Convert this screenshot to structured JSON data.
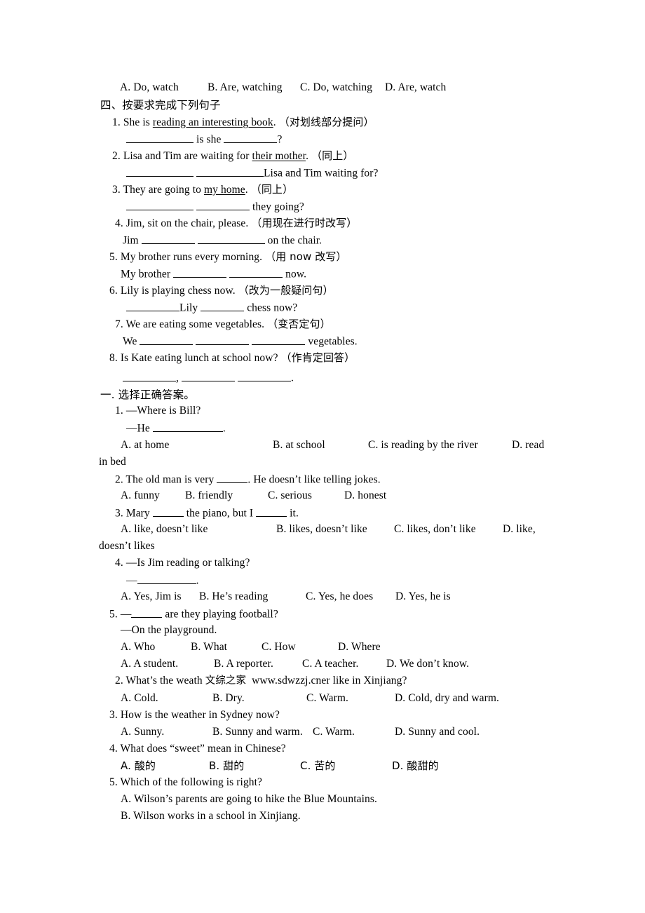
{
  "document": {
    "type": "exam-worksheet",
    "language": "en-zh",
    "page_background": "#ffffff",
    "text_color": "#000000"
  },
  "watermark": {
    "chinese": "文综之家",
    "url": "www.sdwzzj.cn",
    "host_word_prefix": "weath",
    "host_word_suffix": "er"
  },
  "top_options": {
    "a": "A. Do, watch",
    "b": "B. Are, watching",
    "c": "C. Do, watching",
    "d": "D. Are, watch"
  },
  "section_four": {
    "heading": "四、按要求完成下列句子",
    "items": [
      {
        "num": "1.",
        "stem_pre": "She is ",
        "stem_underlined": "reading an interesting book",
        "stem_post": ".",
        "instruction": "（对划线部分提问）",
        "answer_pre": "",
        "answer_mid": " is she ",
        "answer_post": "?"
      },
      {
        "num": "2.",
        "stem_pre": "Lisa and Tim are waiting for ",
        "stem_underlined": "their mother",
        "stem_post": ".",
        "instruction": "（同上）",
        "answer_pre": "",
        "answer_mid": " ",
        "answer_post": "Lisa and Tim waiting for?"
      },
      {
        "num": "3.",
        "stem_pre": "They are going to ",
        "stem_underlined": "my home",
        "stem_post": ".",
        "instruction": "（同上）",
        "answer_pre": "",
        "answer_mid": " ",
        "answer_post": " they going?"
      },
      {
        "num": "4.",
        "stem_pre": "Jim, sit on the chair, please.",
        "stem_underlined": "",
        "stem_post": "",
        "instruction": "（用现在进行时改写）",
        "answer_pre": "Jim ",
        "answer_mid": " ",
        "answer_post": " on the chair."
      },
      {
        "num": "5.",
        "stem_pre": "My brother runs every morning.",
        "stem_underlined": "",
        "stem_post": "",
        "instruction": "（用 now 改写）",
        "answer_pre": "My brother ",
        "answer_mid": " ",
        "answer_post": " now."
      },
      {
        "num": "6.",
        "stem_pre": "Lily is playing chess now.",
        "stem_underlined": "",
        "stem_post": "",
        "instruction": "（改为一般疑问句）",
        "answer_pre": "",
        "answer_mid": "Lily ",
        "answer_post": " chess now?"
      },
      {
        "num": "7.",
        "stem_pre": "We are eating some vegetables.",
        "stem_underlined": "",
        "stem_post": "",
        "instruction": "（变否定句）",
        "answer_pre": "We ",
        "answer_mid": " ",
        "answer_post": " vegetables."
      },
      {
        "num": "8.",
        "stem_pre": "Is Kate eating lunch at school now?",
        "stem_underlined": "",
        "stem_post": "",
        "instruction": "（作肯定回答）",
        "answer_pre": "",
        "answer_mid": ", ",
        "answer_post": "."
      }
    ]
  },
  "section_one": {
    "heading": "一. 选择正确答案。",
    "questions": [
      {
        "num": "1.",
        "stem": "—Where is Bill?",
        "stem2_pre": "—He ",
        "stem2_post": ".",
        "options_line": [
          "A. at home",
          "B. at school",
          "C. is reading by the river",
          "D. read"
        ],
        "wrap": "in bed"
      },
      {
        "num": "2.",
        "stem_pre": "The old man is very ",
        "stem_post": ". He doesn’t like telling jokes.",
        "options_line": [
          "A. funny",
          "B. friendly",
          "C. serious",
          "D. honest"
        ]
      },
      {
        "num": "3.",
        "stem_pre": "Mary ",
        "stem_mid": " the piano, but I ",
        "stem_post": " it.",
        "options_line": [
          "A. like, doesn’t like",
          "B. likes, doesn’t like",
          "C. likes, don’t like",
          "D. like,"
        ],
        "wrap": "doesn’t likes"
      },
      {
        "num": "4.",
        "stem": "—Is Jim reading or talking?",
        "stem2_pre": "—",
        "stem2_post": ".",
        "options_line": [
          "A. Yes, Jim is",
          "B. He’s reading",
          "C. Yes, he does",
          "D. Yes, he is"
        ]
      },
      {
        "num": "5.",
        "stem_pre": "—",
        "stem_post": " are they playing football?",
        "stem2": "—On the playground.",
        "options_line": [
          "A. Who",
          "B. What",
          "C. How",
          "D. Where"
        ],
        "options_line2": [
          "A. A student.",
          "B. A reporter.",
          "C. A teacher.",
          "D. We don’t know."
        ]
      }
    ]
  },
  "reading_questions": [
    {
      "num": "2.",
      "stem_pre": "What’s the ",
      "stem_post": " like in Xinjiang?",
      "options_line": [
        "A. Cold.",
        "B. Dry.",
        "C. Warm.",
        "D. Cold, dry and warm."
      ]
    },
    {
      "num": "3.",
      "stem": "How is the weather in Sydney now?",
      "options_line": [
        "A. Sunny.",
        "B. Sunny and warm.",
        "C. Warm.",
        "D. Sunny and cool."
      ]
    },
    {
      "num": "4.",
      "stem": "What does “sweet” mean in Chinese?",
      "options_line": [
        "A. 酸的",
        "B. 甜的",
        "C. 苦的",
        "D. 酸甜的"
      ]
    },
    {
      "num": "5.",
      "stem": "Which of the following is right?",
      "options_stacked": [
        "A. Wilson’s parents are going to hike the Blue Mountains.",
        "B. Wilson works in a school in Xinjiang."
      ]
    }
  ]
}
